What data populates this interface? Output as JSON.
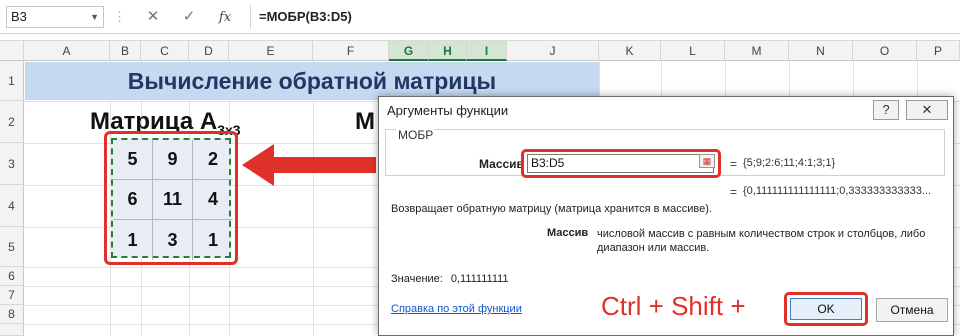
{
  "formula_bar": {
    "name_box": "B3",
    "cancel_glyph": "✕",
    "enter_glyph": "✓",
    "fx_label": "fx",
    "formula": "=МОБР(B3:D5)"
  },
  "columns": [
    "A",
    "B",
    "C",
    "D",
    "E",
    "F",
    "G",
    "H",
    "I",
    "J",
    "K",
    "L",
    "M",
    "N",
    "O",
    "P"
  ],
  "selected_columns": [
    "G",
    "H",
    "I"
  ],
  "rows": [
    "1",
    "2",
    "3",
    "4",
    "5",
    "6",
    "7",
    "8"
  ],
  "sheet": {
    "title": "Вычисление обратной матрицы",
    "matrix_a_label": "Матрица A",
    "matrix_a_subscript": "3x3",
    "matrix_b_label": "М",
    "matrix": [
      [
        "5",
        "9",
        "2"
      ],
      [
        "6",
        "11",
        "4"
      ],
      [
        "1",
        "3",
        "1"
      ]
    ]
  },
  "dialog": {
    "title": "Аргументы функции",
    "help_glyph": "?",
    "close_glyph": "✕",
    "function_name": "МОБР",
    "arg_label": "Массив",
    "arg_value": "B3:D5",
    "arg_eq": "=",
    "arg_result": "{5;9;2:6;11;4:1;3;1}",
    "result_eq": "=",
    "result_preview": "{0,111111111111111;0,333333333333...",
    "description": "Возвращает обратную матрицу (матрица хранится в массиве).",
    "arg_desc_name": "Массив",
    "arg_desc": "числовой массив с равным количеством строк и столбцов, либо диапазон или массив.",
    "value_label": "Значение:",
    "value": "0,111111111",
    "help_link": "Справка по этой функции",
    "ok_label": "OK",
    "cancel_label": "Отмена"
  },
  "annotation": {
    "hint": "Ctrl + Shift +"
  },
  "colors": {
    "highlight": "#e0302a",
    "title_band": "#c5d9f1",
    "selected_header": "#d3e6d3"
  }
}
